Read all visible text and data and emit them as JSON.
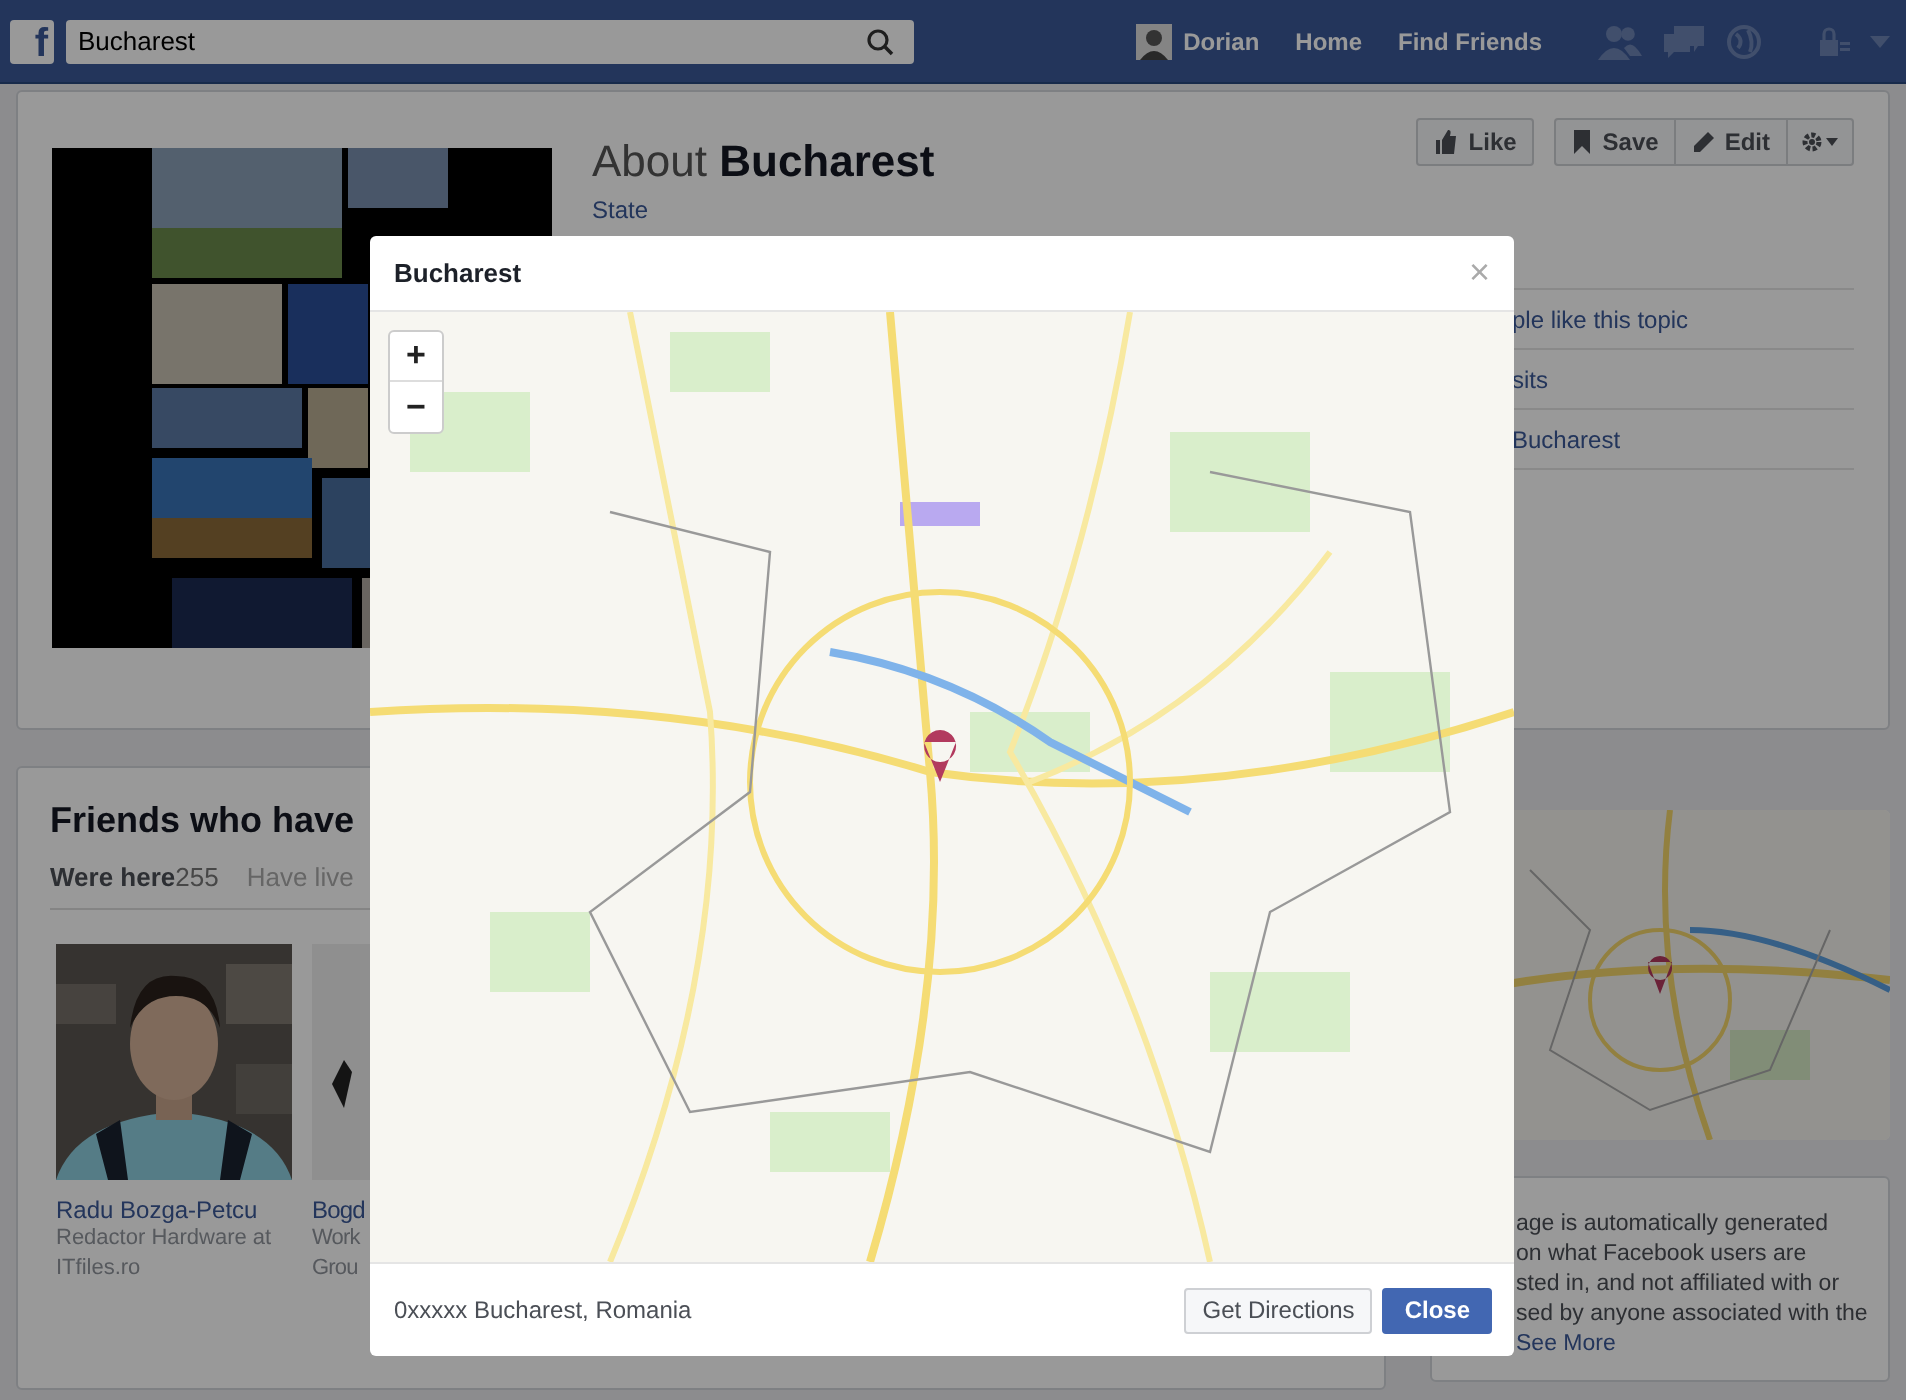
{
  "top_bar": {
    "logo": "f",
    "search": {
      "value": "Bucharest"
    },
    "user": "Dorian",
    "nav": [
      "Home",
      "Find Friends"
    ]
  },
  "about": {
    "title_prefix": "About",
    "title": "Bucharest",
    "category": "State",
    "buttons": [
      {
        "kind": "like",
        "label": "Like"
      },
      {
        "kind": "save",
        "label": "Save"
      },
      {
        "kind": "edit",
        "label": "Edit"
      },
      {
        "kind": "settings"
      }
    ]
  },
  "side_rows": [
    "ple like this topic",
    "sits",
    "Bucharest"
  ],
  "friends": {
    "title": "Friends who have",
    "tabs": [
      {
        "label": "Were here",
        "count": "255",
        "selected": true
      },
      {
        "label": "Have live",
        "selected": false
      }
    ],
    "people": [
      {
        "name": "Radu Bozga-Petcu",
        "description": "Redactor Hardware at ITfiles.ro",
        "kind": "person"
      },
      {
        "name": "Bogd",
        "description": "Work Grou",
        "kind": "blank"
      }
    ]
  },
  "about_text": {
    "lines": [
      "age is automatically generated",
      "on what Facebook users are",
      "sted in, and not affiliated with or",
      "sed by anyone associated with the"
    ],
    "link": "See More"
  },
  "dialog": {
    "title": "Bucharest",
    "close": "×",
    "zoom": [
      "+",
      "−"
    ],
    "address": "0xxxxx Bucharest, Romania",
    "buttons": [
      {
        "label": "Get Directions",
        "primary": false
      },
      {
        "label": "Close",
        "primary": true
      }
    ]
  }
}
